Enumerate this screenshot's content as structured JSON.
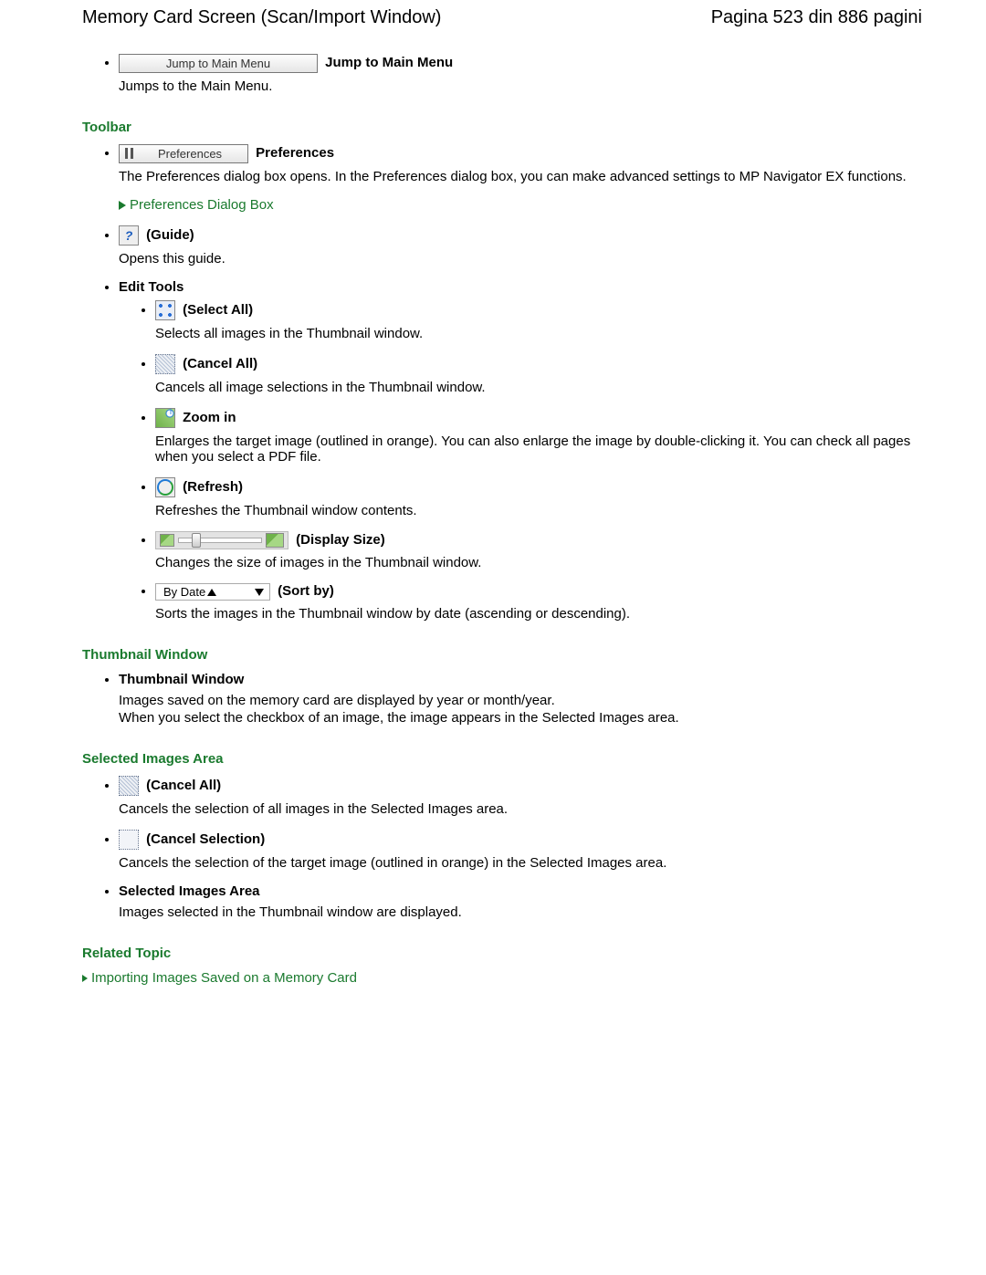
{
  "header": {
    "title": "Memory Card Screen (Scan/Import Window)",
    "pagination": "Pagina 523 din 886 pagini"
  },
  "jump": {
    "button_label": "Jump to Main Menu",
    "label": "Jump to Main Menu",
    "desc": "Jumps to the Main Menu."
  },
  "toolbar": {
    "heading": "Toolbar",
    "preferences": {
      "button_label": "Preferences",
      "label": "Preferences",
      "desc": "The Preferences dialog box opens. In the Preferences dialog box, you can make advanced settings to MP Navigator EX functions.",
      "link": "Preferences Dialog Box"
    },
    "guide": {
      "label": "(Guide)",
      "desc": "Opens this guide."
    },
    "edit_tools_label": "Edit Tools",
    "select_all": {
      "label": "(Select All)",
      "desc": "Selects all images in the Thumbnail window."
    },
    "cancel_all": {
      "label": "(Cancel All)",
      "desc": "Cancels all image selections in the Thumbnail window."
    },
    "zoom_in": {
      "label": "Zoom in",
      "desc": "Enlarges the target image (outlined in orange). You can also enlarge the image by double-clicking it. You can check all pages when you select a PDF file."
    },
    "refresh": {
      "label": "(Refresh)",
      "desc": "Refreshes the Thumbnail window contents."
    },
    "display_size": {
      "label": "(Display Size)",
      "desc": "Changes the size of images in the Thumbnail window."
    },
    "sort_by": {
      "selected": "By Date",
      "label": "(Sort by)",
      "desc": "Sorts the images in the Thumbnail window by date (ascending or descending)."
    }
  },
  "thumbnail": {
    "heading": "Thumbnail Window",
    "sub_label": "Thumbnail Window",
    "desc1": "Images saved on the memory card are displayed by year or month/year.",
    "desc2": "When you select the checkbox of an image, the image appears in the Selected Images area."
  },
  "selected": {
    "heading": "Selected Images Area",
    "cancel_all": {
      "label": "(Cancel All)",
      "desc": "Cancels the selection of all images in the Selected Images area."
    },
    "cancel_selection": {
      "label": "(Cancel Selection)",
      "desc": "Cancels the selection of the target image (outlined in orange) in the Selected Images area."
    },
    "area": {
      "label": "Selected Images Area",
      "desc": "Images selected in the Thumbnail window are displayed."
    }
  },
  "related": {
    "heading": "Related Topic",
    "link": "Importing Images Saved on a Memory Card"
  }
}
